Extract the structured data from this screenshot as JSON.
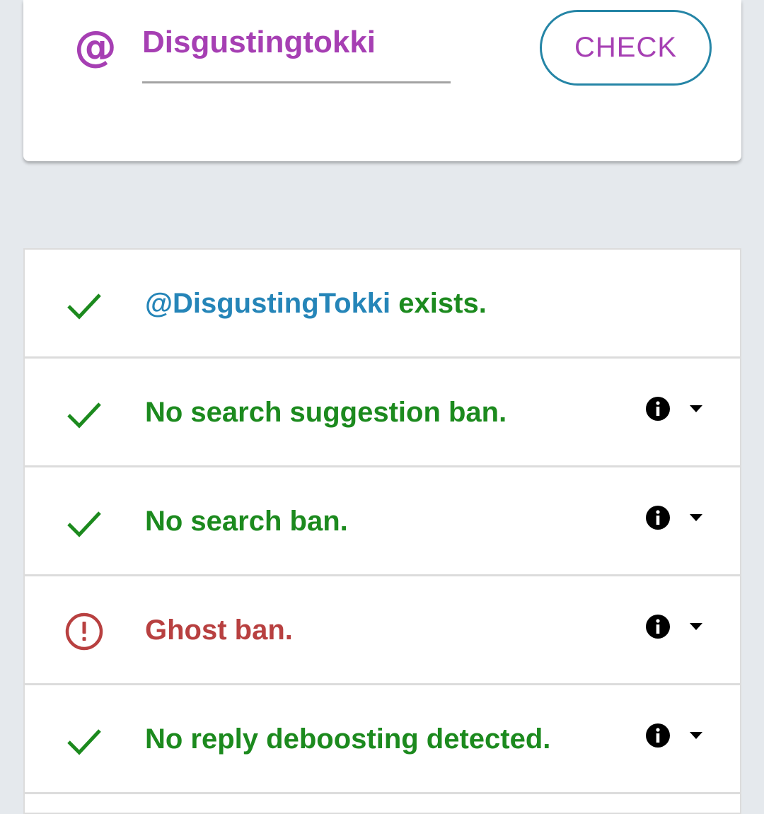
{
  "search": {
    "at_symbol": "@",
    "handle_value": "Disgustingtokki",
    "button_label": "CHECK"
  },
  "results": [
    {
      "status": "ok",
      "icon": "check-icon",
      "handle": "@DisgustingTokki",
      "text": " exists.",
      "has_info": false
    },
    {
      "status": "ok",
      "icon": "check-icon",
      "text": "No search suggestion ban.",
      "has_info": true
    },
    {
      "status": "ok",
      "icon": "check-icon",
      "text": "No search ban.",
      "has_info": true
    },
    {
      "status": "bad",
      "icon": "alert-icon",
      "text": "Ghost ban.",
      "has_info": true
    },
    {
      "status": "ok",
      "icon": "check-icon",
      "text": "No reply deboosting detected.",
      "has_info": true
    }
  ],
  "colors": {
    "accent_purple": "#a63fb3",
    "ok_green": "#1c8a1e",
    "ban_red": "#b84040",
    "link_blue": "#2585b8",
    "button_border": "#2585a6",
    "background": "#e5e9ed"
  }
}
